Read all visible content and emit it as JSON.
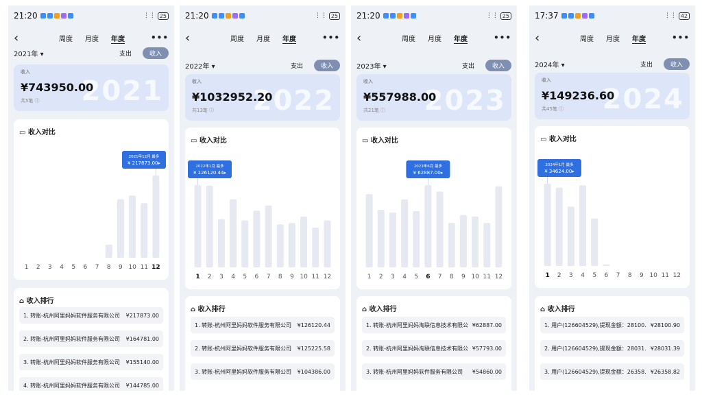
{
  "colors": {
    "bar": "#e6e9f2",
    "bar_hi": "#e6e9f2",
    "tooltip": "#2f6fe0",
    "summary_bg": "#dce6f8",
    "toggle_on": "#7e8fb2"
  },
  "icons": {
    "calendar": "calendar-icon",
    "bank": "bank-icon",
    "info": "info-icon",
    "back": "back-arrow-icon",
    "more": "more-dots-icon"
  },
  "tabs": [
    "周度",
    "月度",
    "年度"
  ],
  "months": [
    "1",
    "2",
    "3",
    "4",
    "5",
    "6",
    "7",
    "8",
    "9",
    "10",
    "11",
    "12"
  ],
  "screens": [
    {
      "time": "21:20",
      "battery": "25",
      "year_label": "2021年 ▾",
      "expense_label": "支出",
      "income_label": "收入",
      "summary_label": "收入",
      "amount": "¥743950.00",
      "count": "共5笔 ⓘ",
      "year_bg": "2021",
      "chart_title": "收入对比",
      "tooltip_line1": "2021年12月 最多",
      "tooltip_line2": "¥ 217873.00▸",
      "rank_title": "收入排行",
      "ranking": [
        {
          "name": "1. 转账-杭州阿里妈妈软件服务有限公司",
          "amount": "¥217873.00"
        },
        {
          "name": "2. 转账-杭州阿里妈妈软件服务有限公司",
          "amount": "¥164781.00"
        },
        {
          "name": "3. 转账-杭州阿里妈妈软件服务有限公司",
          "amount": "¥155140.00"
        },
        {
          "name": "4. 转账-杭州阿里妈妈软件服务有限公司",
          "amount": "¥144785.00"
        }
      ],
      "chart_data": {
        "type": "bar",
        "categories": [
          "1",
          "2",
          "3",
          "4",
          "5",
          "6",
          "7",
          "8",
          "9",
          "10",
          "11",
          "12"
        ],
        "values": [
          0,
          0,
          0,
          0,
          0,
          0,
          0,
          35000,
          155000,
          164781,
          144785,
          217873
        ],
        "highlight": 12
      }
    },
    {
      "time": "21:20",
      "battery": "25",
      "year_label": "2022年 ▾",
      "expense_label": "支出",
      "income_label": "收入",
      "summary_label": "收入",
      "amount": "¥1032952.20",
      "count": "共13笔 ⓘ",
      "year_bg": "2022",
      "chart_title": "收入对比",
      "tooltip_line1": "2022年1月 最多",
      "tooltip_line2": "¥ 126120.44▸",
      "rank_title": "收入排行",
      "ranking": [
        {
          "name": "1. 转账-杭州阿里妈妈软件服务有限公司",
          "amount": "¥126120.44"
        },
        {
          "name": "2. 转账-杭州阿里妈妈软件服务有限公司",
          "amount": "¥125225.58"
        },
        {
          "name": "3. 转账-杭州阿里妈妈软件服务有限公司",
          "amount": "¥104386.00"
        }
      ],
      "chart_data": {
        "type": "bar",
        "categories": [
          "1",
          "2",
          "3",
          "4",
          "5",
          "6",
          "7",
          "8",
          "9",
          "10",
          "11",
          "12"
        ],
        "values": [
          126120,
          125225,
          74000,
          104386,
          72000,
          87000,
          95000,
          66000,
          68000,
          78000,
          61000,
          72000
        ],
        "highlight": 1
      }
    },
    {
      "time": "21:20",
      "battery": "25",
      "year_label": "2023年 ▾",
      "expense_label": "支出",
      "income_label": "收入",
      "summary_label": "收入",
      "amount": "¥557988.00",
      "count": "共21笔 ⓘ",
      "year_bg": "2023",
      "chart_title": "收入对比",
      "tooltip_line1": "2023年6月 最多",
      "tooltip_line2": "¥ 62887.00▸",
      "rank_title": "收入排行",
      "ranking": [
        {
          "name": "1. 转账-杭州阿里妈妈淘联信息技术有限公...",
          "amount": "¥62887.00"
        },
        {
          "name": "2. 转账-杭州阿里妈妈淘联信息技术有限公...",
          "amount": "¥57793.00"
        },
        {
          "name": "3. 转账-杭州阿里妈妈软件服务有限公司",
          "amount": "¥54860.00"
        }
      ],
      "chart_data": {
        "type": "bar",
        "categories": [
          "1",
          "2",
          "3",
          "4",
          "5",
          "6",
          "7",
          "8",
          "9",
          "10",
          "11",
          "12"
        ],
        "values": [
          56000,
          44000,
          42000,
          52000,
          43000,
          62887,
          58000,
          34000,
          40000,
          39000,
          34000,
          62000
        ],
        "highlight": 6
      }
    },
    {
      "time": "17:37",
      "battery": "42",
      "year_label": "2024年 ▾",
      "expense_label": "支出",
      "income_label": "收入",
      "summary_label": "收入",
      "amount": "¥149236.60",
      "count": "共45笔 ⓘ",
      "year_bg": "2024",
      "chart_title": "收入对比",
      "tooltip_line1": "2024年1月 最多",
      "tooltip_line2": "¥ 34624.00▸",
      "rank_title": "收入排行",
      "ranking": [
        {
          "name": "1. 用户(126604529),提现金额：28100.90-...",
          "amount": "¥28100.90"
        },
        {
          "name": "2. 用户(126604529),提现金额：28031.39-...",
          "amount": "¥28031.39"
        },
        {
          "name": "3. 用户(126604529),提现金额：26358.82-...",
          "amount": "¥26358.82"
        }
      ],
      "chart_data": {
        "type": "bar",
        "categories": [
          "1",
          "2",
          "3",
          "4",
          "5",
          "6",
          "7",
          "8",
          "9",
          "10",
          "11",
          "12"
        ],
        "values": [
          34624,
          33000,
          25000,
          34000,
          20000,
          700,
          0,
          0,
          0,
          0,
          0,
          0
        ],
        "highlight": 1
      }
    }
  ]
}
